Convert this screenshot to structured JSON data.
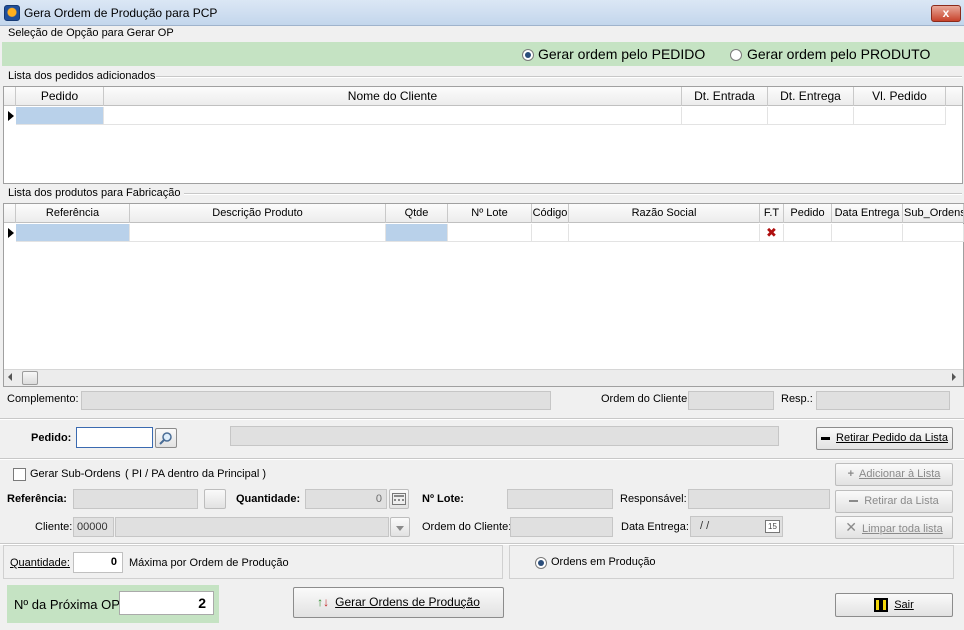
{
  "window": {
    "title": "Gera Ordem de Produção para PCP",
    "close_glyph": "x"
  },
  "selecao": {
    "label": "Seleção de Opção para Gerar OP",
    "option_pedido": "Gerar ordem pelo PEDIDO",
    "option_produto": "Gerar ordem pelo PRODUTO",
    "selected": "pedido"
  },
  "pedidos": {
    "label": "Lista dos pedidos adicionados",
    "columns": [
      "Pedido",
      "Nome do Cliente",
      "Dt. Entrada",
      "Dt. Entrega",
      "Vl. Pedido"
    ]
  },
  "produtos": {
    "label": "Lista dos produtos para Fabricação",
    "columns": [
      "Referência",
      "Descrição Produto",
      "Qtde",
      "Nº Lote",
      "Código",
      "Razão Social",
      "F.T",
      "Pedido",
      "Data Entrega",
      "Sub_Ordens"
    ],
    "ft_glyph": "✖"
  },
  "info": {
    "complemento_label": "Complemento:",
    "ordem_cliente_label": "Ordem do Cliente:",
    "resp_label": "Resp.:"
  },
  "pedido_bar": {
    "label": "Pedido:",
    "value": "",
    "retirar_label": "Retirar Pedido da Lista"
  },
  "sub_ordens": {
    "checkbox_label": "Gerar Sub-Ordens",
    "hint": "( PI / PA dentro da Principal )",
    "checked": false,
    "referencia_label": "Referência:",
    "quantidade_label": "Quantidade:",
    "quantidade_value": "0",
    "lote_label": "Nº Lote:",
    "responsavel_label": "Responsável:",
    "cliente_label": "Cliente:",
    "cliente_code": "00000",
    "ordem_cliente_label": "Ordem do Cliente:",
    "data_entrega_label": "Data Entrega:",
    "data_entrega_value": "/ /",
    "calendar_glyph": "15",
    "adicionar_label": "Adicionar à Lista",
    "retirar_label": "Retirar da Lista",
    "limpar_label": "Limpar toda lista"
  },
  "quantidade_bar": {
    "label": "Quantidade:",
    "value": "0",
    "suffix": "Máxima por Ordem de Produção",
    "radio_label": "Ordens em Produção",
    "radio_selected": true
  },
  "footer": {
    "proxima_label": "Nº da Próxima OP:",
    "proxima_value": "2",
    "gerar_label": "Gerar Ordens de Produção",
    "sair_label": "Sair"
  },
  "colors": {
    "accent_green": "#c5e3c3",
    "selection_blue": "#b9d1ea",
    "title_bg": "#c3d6ec"
  }
}
